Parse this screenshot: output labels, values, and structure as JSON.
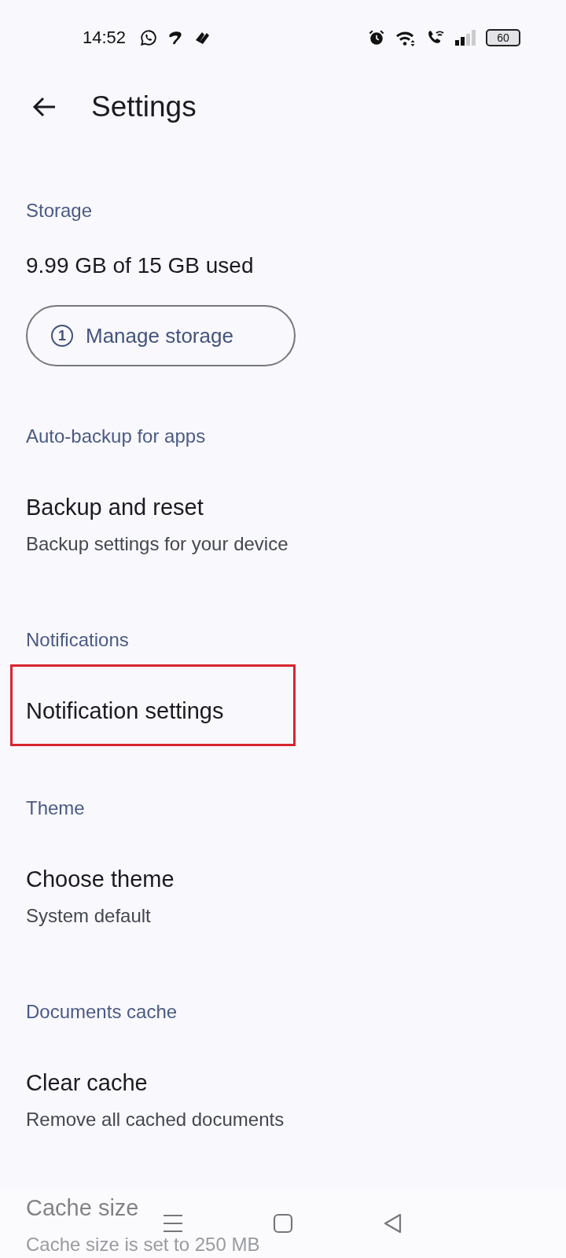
{
  "status_bar": {
    "time": "14:52",
    "battery": "60"
  },
  "header": {
    "title": "Settings"
  },
  "sections": [
    {
      "header": "Storage",
      "items": [
        {
          "kind": "value",
          "title": "9.99 GB of 15 GB used"
        },
        {
          "kind": "button",
          "badge": "1",
          "title": "Manage storage"
        }
      ]
    },
    {
      "header": "Auto-backup for apps",
      "items": [
        {
          "kind": "entry",
          "title": "Backup and reset",
          "subtitle": "Backup settings for your device",
          "highlighted": false
        }
      ]
    },
    {
      "header": "Notifications",
      "items": [
        {
          "kind": "entry",
          "title": "Notification settings",
          "highlighted": true
        }
      ]
    },
    {
      "header": "Theme",
      "items": [
        {
          "kind": "entry",
          "title": "Choose theme",
          "subtitle": "System default",
          "highlighted": false
        }
      ]
    },
    {
      "header": "Documents cache",
      "items": [
        {
          "kind": "entry",
          "title": "Clear cache",
          "subtitle": "Remove all cached documents",
          "highlighted": false
        },
        {
          "kind": "entry",
          "title": "Cache size",
          "subtitle": "Cache size is set to 250 MB",
          "highlighted": false
        }
      ]
    }
  ]
}
